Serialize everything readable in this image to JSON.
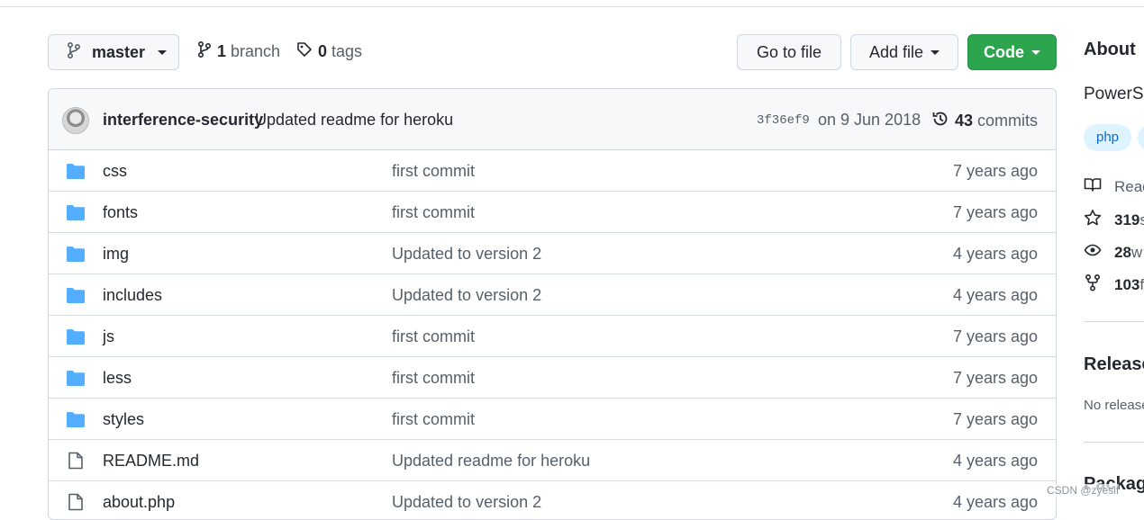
{
  "toolbar": {
    "branch_label": "master",
    "branch_count": "1",
    "branch_word": "branch",
    "tag_count": "0",
    "tag_word": "tags",
    "go_to_file": "Go to file",
    "add_file": "Add file",
    "code": "Code"
  },
  "commit": {
    "author": "interference-security",
    "message": "Updated readme for heroku",
    "sha": "3f36ef9",
    "date": "on 9 Jun 2018",
    "count": "43",
    "count_word": "commits"
  },
  "files": [
    {
      "type": "folder",
      "name": "css",
      "message": "first commit",
      "age": "7 years ago"
    },
    {
      "type": "folder",
      "name": "fonts",
      "message": "first commit",
      "age": "7 years ago"
    },
    {
      "type": "folder",
      "name": "img",
      "message": "Updated to version 2",
      "age": "4 years ago"
    },
    {
      "type": "folder",
      "name": "includes",
      "message": "Updated to version 2",
      "age": "4 years ago"
    },
    {
      "type": "folder",
      "name": "js",
      "message": "first commit",
      "age": "7 years ago"
    },
    {
      "type": "folder",
      "name": "less",
      "message": "first commit",
      "age": "7 years ago"
    },
    {
      "type": "folder",
      "name": "styles",
      "message": "first commit",
      "age": "7 years ago"
    },
    {
      "type": "file",
      "name": "README.md",
      "message": "Updated readme for heroku",
      "age": "4 years ago"
    },
    {
      "type": "file",
      "name": "about.php",
      "message": "Updated to version 2",
      "age": "4 years ago"
    }
  ],
  "about": {
    "heading": "About",
    "description": "PowerSl",
    "topic": "php",
    "readme": "Read",
    "stars": "319",
    "stars_suffix": " s",
    "watchers": "28",
    "watchers_suffix": " w",
    "forks": "103",
    "forks_suffix": " f"
  },
  "releases": {
    "heading": "Release",
    "note": "No release"
  },
  "packages": {
    "heading": "Package"
  },
  "watermark": "CSDN @zyesif"
}
